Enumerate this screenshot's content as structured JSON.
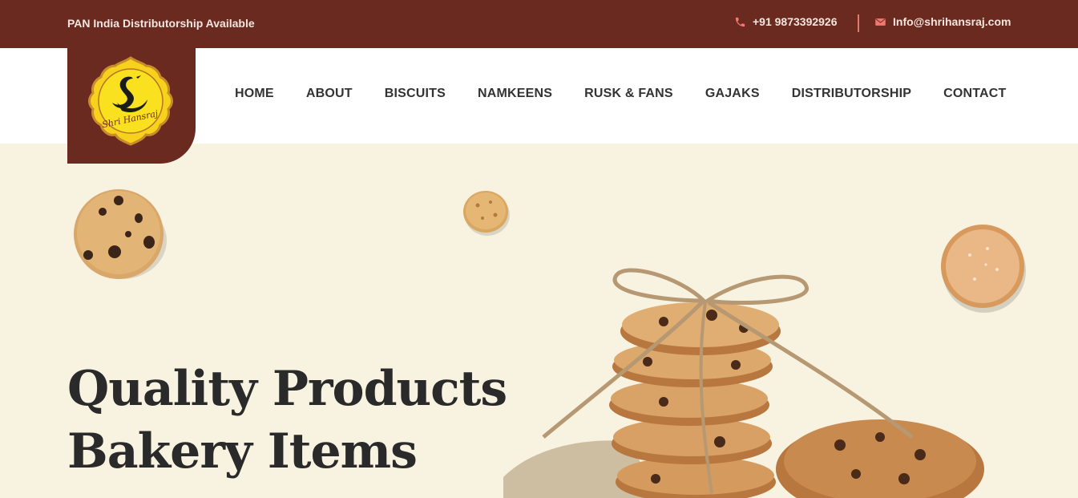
{
  "topbar": {
    "left_text": "PAN India Distributorship Available",
    "phone": "+91 9873392926",
    "email": "Info@shrihansraj.com",
    "icons": {
      "phone": "phone-icon",
      "email": "mail-icon"
    }
  },
  "logo": {
    "alt": "Shri Hansraj"
  },
  "nav": {
    "items": [
      {
        "label": "HOME"
      },
      {
        "label": "ABOUT"
      },
      {
        "label": "BISCUITS"
      },
      {
        "label": "NAMKEENS"
      },
      {
        "label": "RUSK & FANS"
      },
      {
        "label": "GAJAKS"
      },
      {
        "label": "DISTRIBUTORSHIP"
      },
      {
        "label": "CONTACT"
      }
    ]
  },
  "hero": {
    "title_line1": "Quality Products",
    "title_line2": "Bakery Items"
  },
  "colors": {
    "brand": "#6b2a20",
    "hero_bg": "#f8f2e0",
    "accent": "#e07a6a",
    "text_dark": "#2a2a2a"
  }
}
